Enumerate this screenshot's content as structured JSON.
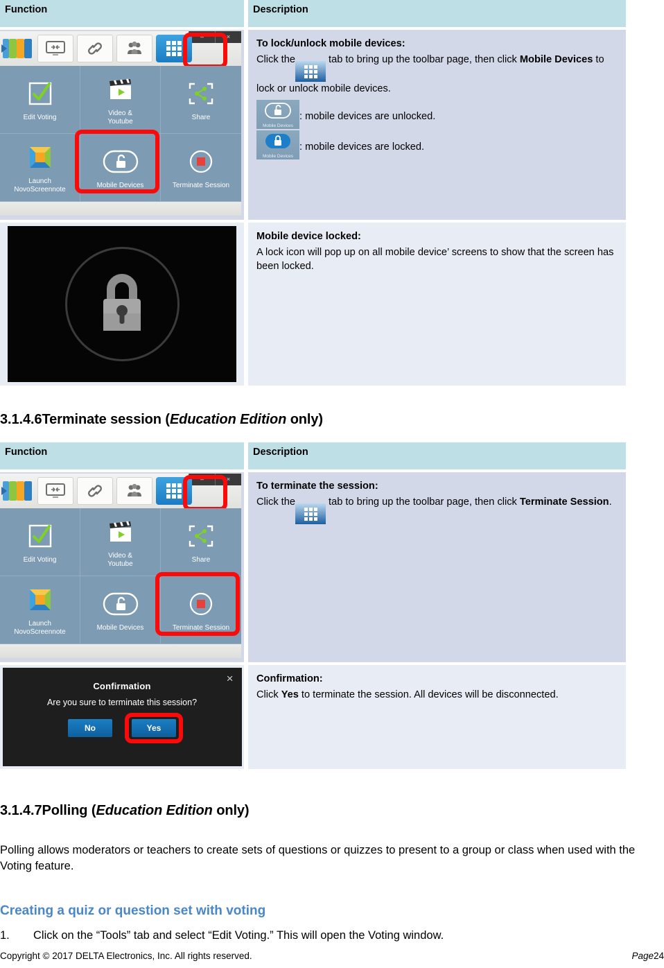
{
  "table1": {
    "headers": [
      "Function",
      "Description"
    ],
    "rows": [
      {
        "shot": "novoconnect-toolbar-mobile-devices",
        "desc_title": "To lock/unlock mobile devices:",
        "desc_line1_a": "Click the",
        "desc_line1_b": "tab to bring up the toolbar page, then click",
        "desc_line1_bold": "Mobile Devices",
        "desc_line1_c": "to lock or unlock mobile devices.",
        "status_unlocked": ": mobile devices are unlocked.",
        "status_locked": ": mobile devices are locked."
      },
      {
        "shot": "mobile-device-lock-screen",
        "desc_title": "Mobile device locked:",
        "desc_body": "A lock icon will pop up on all mobile device’ screens to show that the screen has been locked."
      }
    ]
  },
  "section_346": {
    "number": "3.1.4.6",
    "title_a": "Terminate session (",
    "title_em": "Education Edition",
    "title_b": " only)"
  },
  "table2": {
    "headers": [
      "Function",
      "Description"
    ],
    "rows": [
      {
        "shot": "novoconnect-toolbar-terminate-session",
        "desc_title": "To terminate the session:",
        "desc_line1_a": "Click the",
        "desc_line1_b": "tab to bring up the toolbar page, then click",
        "desc_line1_bold": "Terminate Session",
        "desc_line1_c": "."
      },
      {
        "shot": "terminate-confirmation-dialog",
        "desc_title": "Confirmation:",
        "desc_a": "Click ",
        "desc_bold": "Yes",
        "desc_b": " to terminate the session. All devices will be disconnected."
      }
    ]
  },
  "section_347": {
    "number": "3.1.4.7",
    "title_a": "Polling (",
    "title_em": "Education Edition",
    "title_b": " only)",
    "paragraph": "Polling allows moderators or teachers to create sets of questions or quizzes to present to a group or class when used with the Voting feature."
  },
  "subsection": {
    "heading": "Creating a quiz or question set with voting",
    "step1_num": "1.",
    "step1_text": "Click on the “Tools” tab and select “Edit Voting.” This will open the Voting window."
  },
  "toolbar_shot": {
    "window_minimize": "–",
    "window_close": "×",
    "tiles": [
      {
        "label": "Edit Voting",
        "icon": "checkbox-check-icon"
      },
      {
        "label": "Video &\nYoutube",
        "label_l1": "Video &",
        "label_l2": "Youtube",
        "icon": "clapperboard-play-icon"
      },
      {
        "label": "Share",
        "icon": "share-nodes-icon"
      },
      {
        "label": "Launch\nNovoScreennote",
        "label_l1": "Launch",
        "label_l2": "NovoScreennote",
        "icon": "novoscreennote-icon"
      },
      {
        "label": "Mobile Devices",
        "icon": "padlock-open-icon"
      },
      {
        "label": "Terminate Session",
        "icon": "stop-square-icon"
      }
    ]
  },
  "confirm_dialog": {
    "close": "×",
    "title": "Confirmation",
    "message": "Are you sure to terminate this session?",
    "btn_no": "No",
    "btn_yes": "Yes"
  },
  "mobile_device_icon_label": "Mobile Devices",
  "footer": {
    "copyright": "Copyright © 2017 DELTA Electronics, Inc. All rights reserved.",
    "page_label": "Page",
    "page_number": "24"
  },
  "colors": {
    "table_header": "#bfdfe7",
    "row_dark": "#d3d8e9",
    "row_light": "#e8ecf4",
    "heading_blue": "#4a87c8",
    "highlight_red": "#fb0a0a"
  }
}
